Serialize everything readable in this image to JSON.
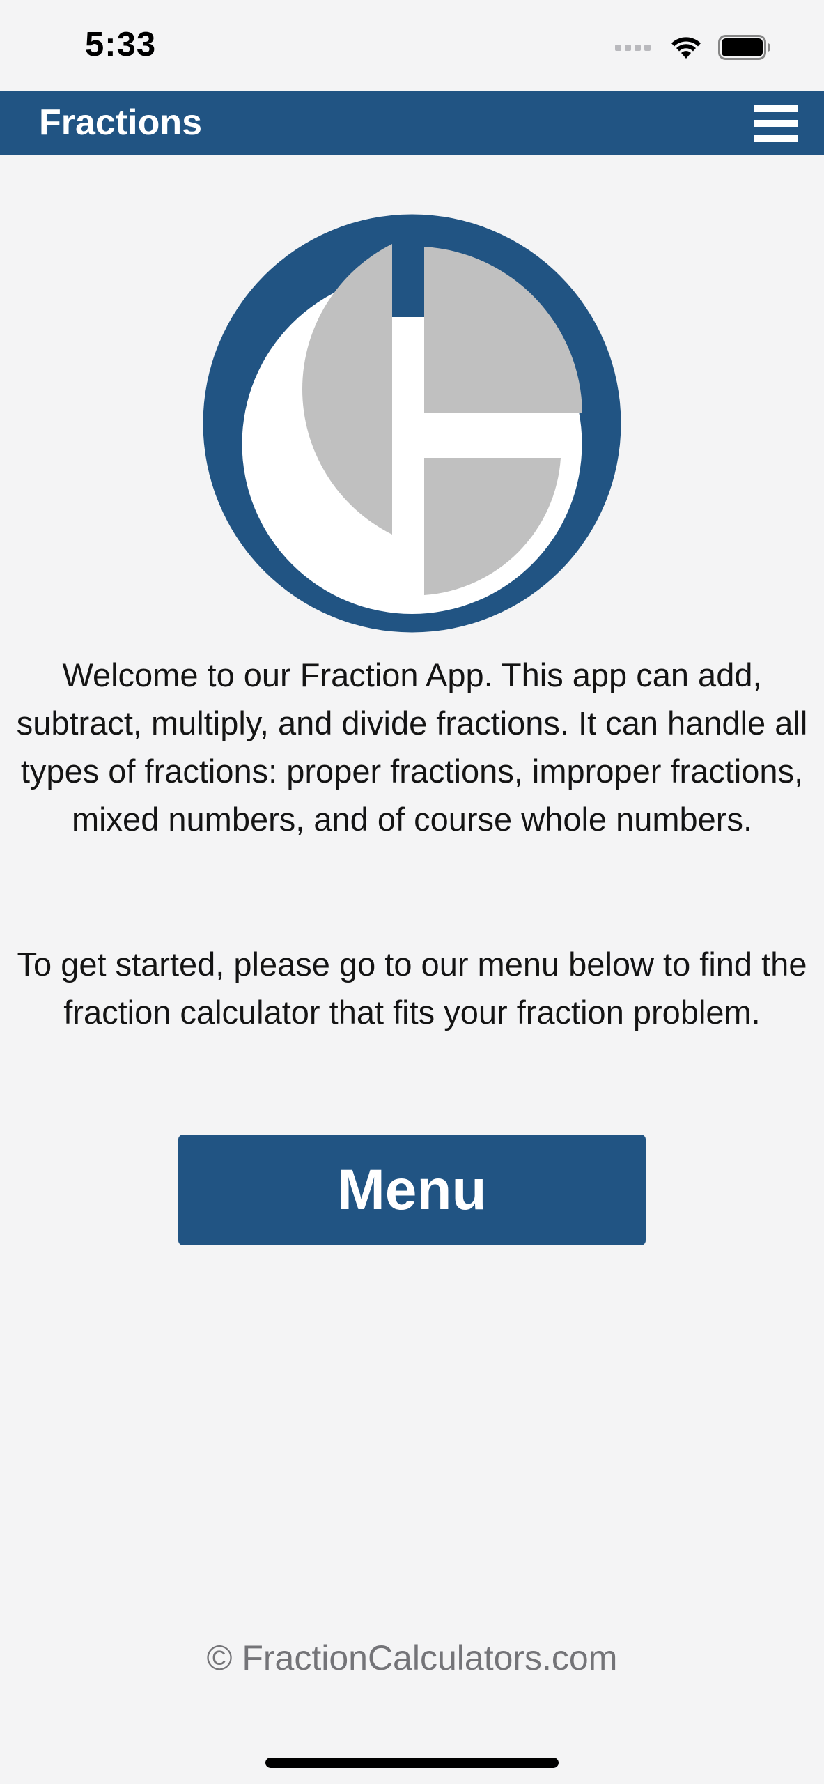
{
  "status_bar": {
    "time": "5:33",
    "icons": [
      "cellular-signal-icon",
      "wifi-icon",
      "battery-icon"
    ]
  },
  "header": {
    "title": "Fractions",
    "menu_icon": "hamburger-menu-icon"
  },
  "logo": {
    "icon": "fraction-pie-logo",
    "colors": {
      "ring": "#215483",
      "slices": "#c0c0c0",
      "background": "#ffffff"
    }
  },
  "content": {
    "welcome_text": "Welcome to our Fraction App. This app can add, subtract, multiply, and divide fractions. It can handle all types of fractions: proper fractions, improper fractions, mixed numbers, and of course whole numbers.",
    "started_text": "To get started, please go to our menu below to find the fraction calculator that fits your fraction problem."
  },
  "menu_button": {
    "label": "Menu"
  },
  "footer": {
    "text": "© FractionCalculators.com"
  },
  "colors": {
    "brand": "#215483",
    "page_background": "#f4f4f5",
    "text": "#141414",
    "footer_text": "#747478"
  }
}
